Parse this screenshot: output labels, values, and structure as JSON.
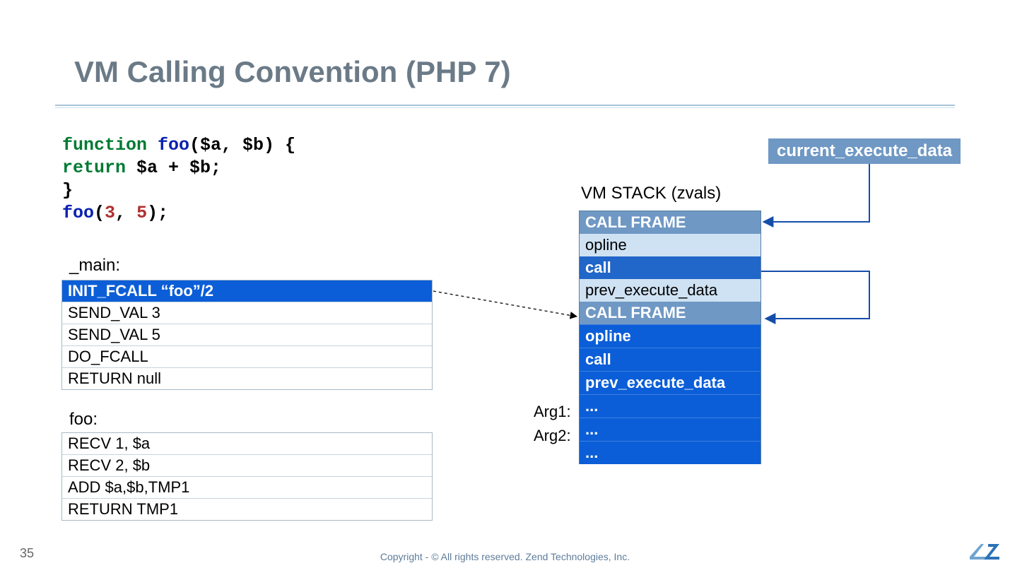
{
  "title": "VM Calling Convention (PHP 7)",
  "code": {
    "l1a": "function ",
    "l1b": "foo",
    "l1c": "($a, $b) {",
    "l2a": "    return ",
    "l2b": "$a + $b;",
    "l3": "}",
    "l4a": "foo",
    "l4b": "(",
    "l4c": "3",
    "l4d": ", ",
    "l4e": "5",
    "l4f": ");"
  },
  "main_label": "_main:",
  "foo_label": "foo:",
  "main_ops": [
    "INIT_FCALL  “foo”/2",
    "SEND_VAL 3",
    "SEND_VAL 5",
    "DO_FCALL",
    "RETURN null"
  ],
  "foo_ops": [
    "RECV 1, $a",
    "RECV 2, $b",
    "ADD $a,$b,TMP1",
    "RETURN TMP1"
  ],
  "vm_title": "VM STACK (zvals)",
  "stack": [
    {
      "t": "CALL FRAME",
      "c": "hdr"
    },
    {
      "t": "opline",
      "c": "pale"
    },
    {
      "t": "call",
      "c": "mid"
    },
    {
      "t": "prev_execute_data",
      "c": "pale"
    },
    {
      "t": "CALL FRAME",
      "c": "hdr"
    },
    {
      "t": "opline",
      "c": "blue"
    },
    {
      "t": "call",
      "c": "blue"
    },
    {
      "t": "prev_execute_data",
      "c": "blue"
    },
    {
      "t": "...",
      "c": "blue"
    },
    {
      "t": "...",
      "c": "blue"
    },
    {
      "t": "...",
      "c": "blue"
    }
  ],
  "arg1": "Arg1:",
  "arg2": "Arg2:",
  "ced": "current_execute_data",
  "pageno": "35",
  "copyright": "Copyright - © All rights reserved. Zend Technologies, Inc."
}
